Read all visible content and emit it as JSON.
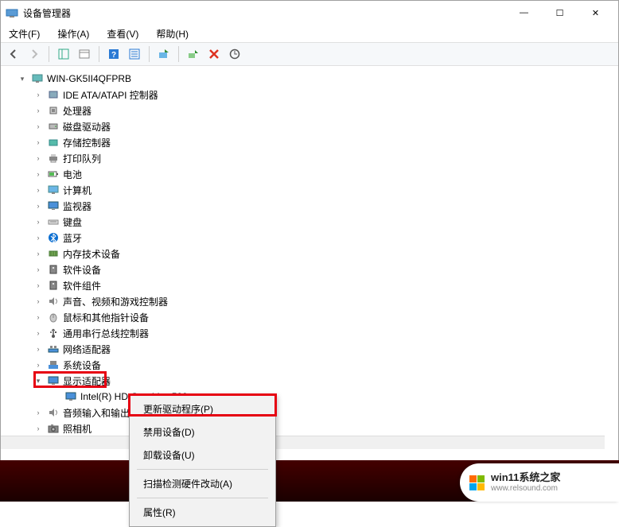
{
  "window": {
    "title": "设备管理器",
    "controls": {
      "minimize": "—",
      "maximize": "☐",
      "close": "✕"
    }
  },
  "menubar": {
    "file": "文件(F)",
    "action": "操作(A)",
    "view": "查看(V)",
    "help": "帮助(H)"
  },
  "tree": {
    "root": "WIN-GK5II4QFPRB",
    "items": [
      "IDE ATA/ATAPI 控制器",
      "处理器",
      "磁盘驱动器",
      "存储控制器",
      "打印队列",
      "电池",
      "计算机",
      "监视器",
      "键盘",
      "蓝牙",
      "内存技术设备",
      "软件设备",
      "软件组件",
      "声音、视频和游戏控制器",
      "鼠标和其他指针设备",
      "通用串行总线控制器",
      "网络适配器",
      "系统设备",
      "显示适配器",
      "音频输入和输出",
      "照相机"
    ],
    "display_child": "Intel(R) HD Graphics 520"
  },
  "context_menu": {
    "update": "更新驱动程序(P)",
    "disable": "禁用设备(D)",
    "uninstall": "卸载设备(U)",
    "scan": "扫描检测硬件改动(A)",
    "properties": "属性(R)"
  },
  "watermark": {
    "line1": "win11系统之家",
    "line2": "www.relsound.com"
  },
  "colors": {
    "highlight": "#e60012",
    "logo1": "#ff6a00",
    "logo2": "#00a4ef",
    "logo3": "#7fba00",
    "logo4": "#ffb900"
  }
}
